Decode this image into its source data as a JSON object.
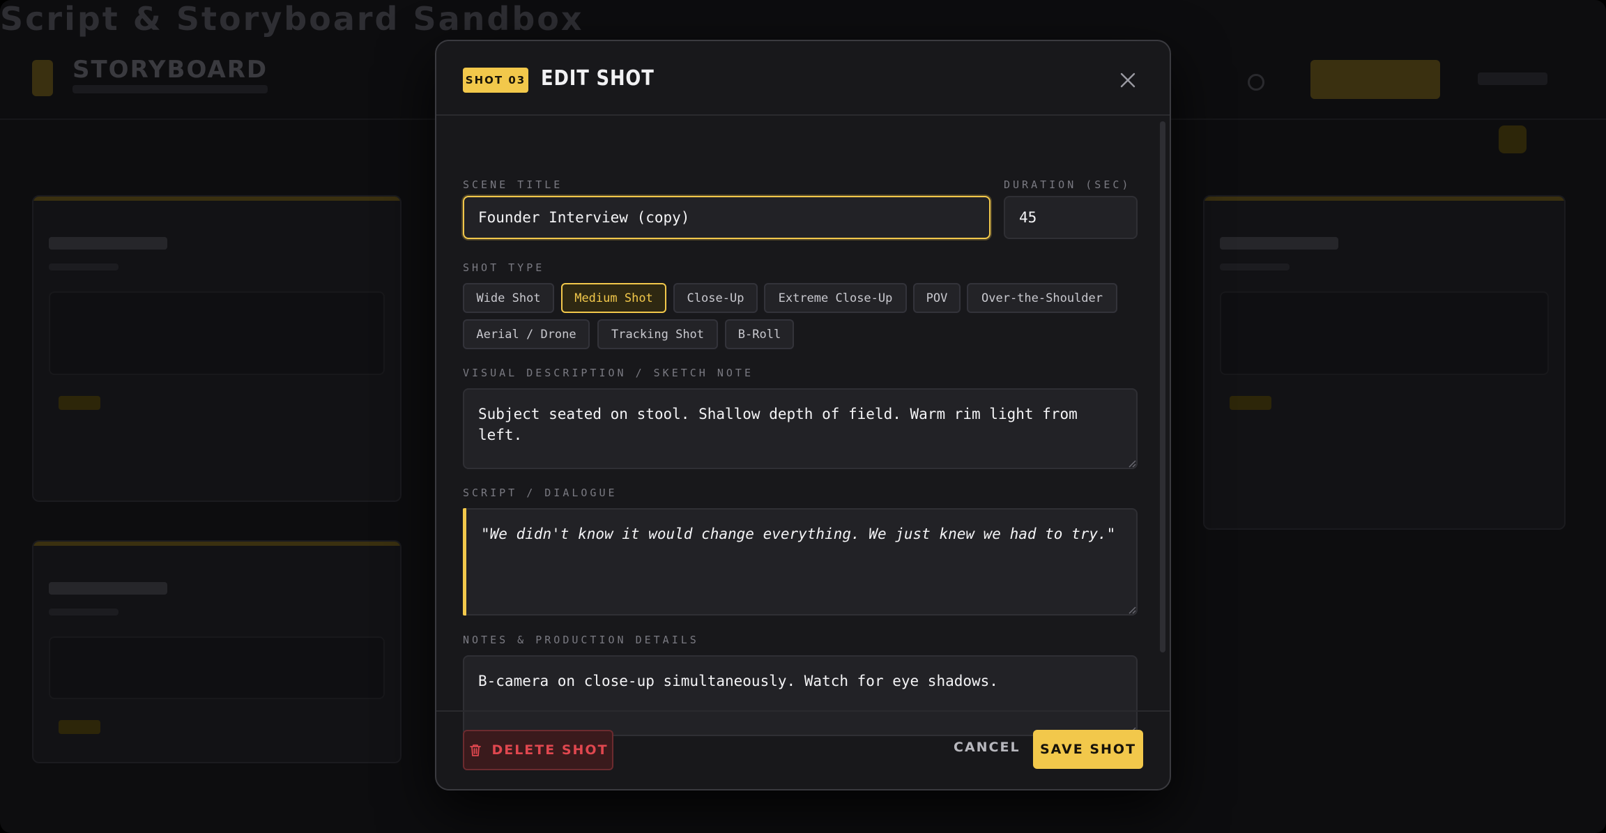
{
  "background": {
    "app_title": "Script & Storyboard Sandbox",
    "brand": "STORYBOARD"
  },
  "modal": {
    "badge": "SHOT 03",
    "title": "EDIT SHOT",
    "close_icon": "close-icon",
    "scene_title": {
      "label": "SCENE TITLE",
      "value": "Founder Interview (copy)"
    },
    "duration": {
      "label": "DURATION (SEC)",
      "value": "45"
    },
    "shot_type": {
      "label": "SHOT TYPE",
      "selected": "Medium Shot",
      "options": [
        "Wide Shot",
        "Medium Shot",
        "Close-Up",
        "Extreme Close-Up",
        "POV",
        "Over-the-Shoulder",
        "Aerial / Drone",
        "Tracking Shot",
        "B-Roll"
      ]
    },
    "visual": {
      "label": "VISUAL DESCRIPTION / SKETCH NOTE",
      "value": "Subject seated on stool. Shallow depth of field. Warm rim light from left."
    },
    "script": {
      "label": "SCRIPT / DIALOGUE",
      "value": "\"We didn't know it would change everything. We just knew we had to try.\""
    },
    "notes": {
      "label": "NOTES & PRODUCTION DETAILS",
      "value": "B-camera on close-up simultaneously. Watch for eye shadows."
    },
    "footer": {
      "delete_label": "DELETE SHOT",
      "delete_icon": "trash-icon",
      "cancel_label": "CANCEL",
      "save_label": "SAVE SHOT"
    }
  },
  "colors": {
    "accent": "#f2c84b",
    "danger": "#e0474f",
    "surface": "#18181b"
  }
}
